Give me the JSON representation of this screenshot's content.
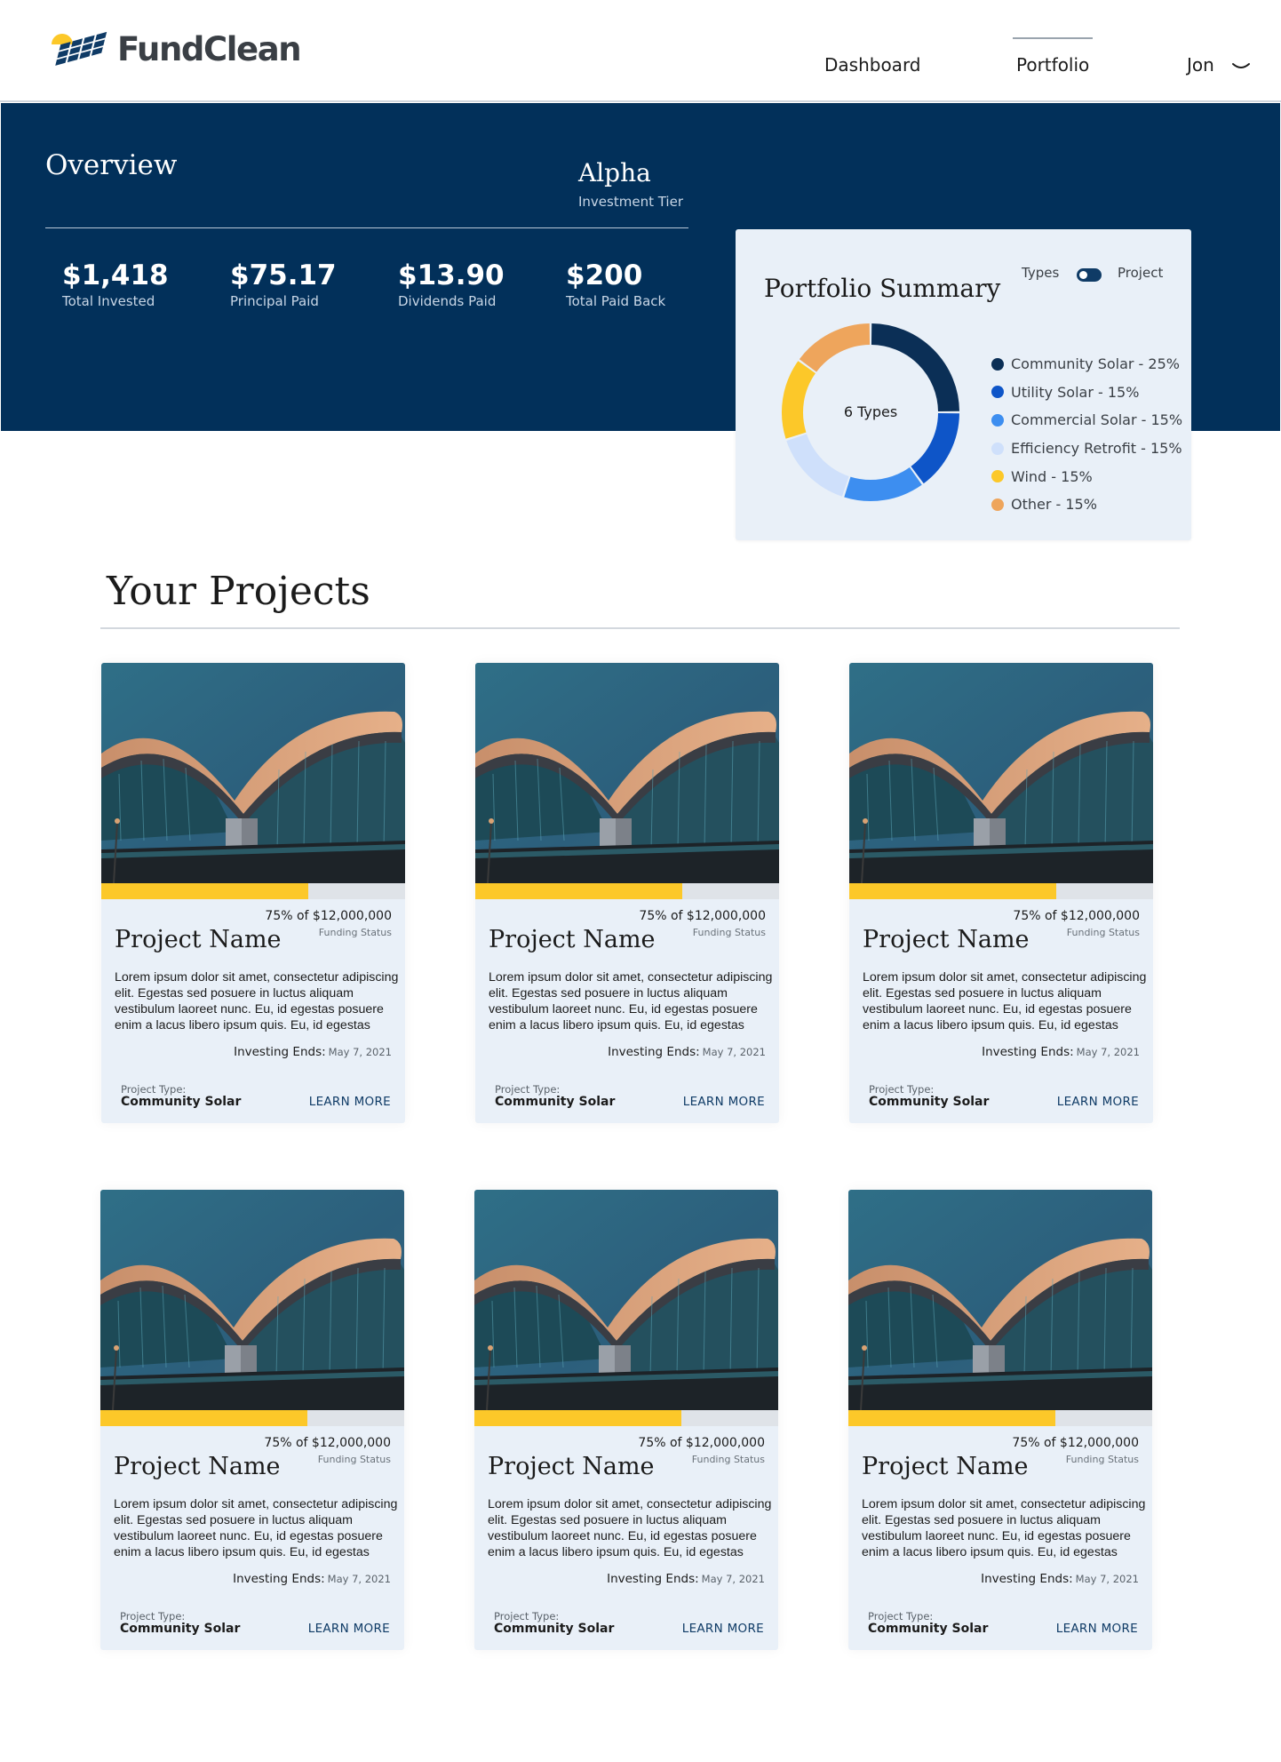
{
  "brand": {
    "name": "FundClean",
    "colors": {
      "navy": "#02305a",
      "accent_yellow": "#fcc829",
      "card_bg": "#e9f0f8",
      "link_blue": "#0f3b66"
    }
  },
  "nav": {
    "items": [
      {
        "label": "Dashboard"
      },
      {
        "label": "Portfolio",
        "active": true
      }
    ],
    "user": {
      "name": "Jon",
      "menu_icon": "chevron-down-icon"
    }
  },
  "overview": {
    "title": "Overview",
    "tier_name": "Alpha",
    "tier_label": "Investment Tier",
    "stats": [
      {
        "value": "$1,418",
        "label": "Total Invested"
      },
      {
        "value": "$75.17",
        "label": "Principal Paid"
      },
      {
        "value": "$13.90",
        "label": "Dividends Paid"
      },
      {
        "value": "$200",
        "label": "Total Paid Back"
      }
    ]
  },
  "summary": {
    "title": "Portfolio Summary",
    "toggle_left": "Types",
    "toggle_right": "Project",
    "center_label": "6 Types",
    "legend": [
      {
        "label": "Community Solar - 25%",
        "value": 25,
        "color": "#0b2f56"
      },
      {
        "label": "Utility Solar - 15%",
        "value": 15,
        "color": "#0e55c8"
      },
      {
        "label": "Commercial Solar - 15%",
        "value": 15,
        "color": "#3d8ef0"
      },
      {
        "label": "Efficiency Retrofit - 15%",
        "value": 15,
        "color": "#cfe0fb"
      },
      {
        "label": "Wind - 15%",
        "value": 15,
        "color": "#fcc829"
      },
      {
        "label": "Other - 15%",
        "value": 15,
        "color": "#eea55c"
      }
    ]
  },
  "projects": {
    "title": "Your Projects",
    "cards": [
      {
        "funding_amount": "75% of $12,000,000",
        "funding_progress": 0.68,
        "funding_label": "Funding Status",
        "name": "Project Name",
        "description": "Lorem ipsum dolor sit amet, consectetur adipiscing elit. Egestas sed posuere in luctus aliquam vestibulum laoreet nunc. Eu, id egestas posuere enim a lacus libero ipsum quis. Eu, id egestas",
        "ends_label": "Investing Ends:",
        "ends_date": "May 7, 2021",
        "type_label": "Project Type:",
        "type": "Community Solar",
        "cta": "LEARN MORE"
      },
      {
        "funding_amount": "75% of $12,000,000",
        "funding_progress": 0.68,
        "funding_label": "Funding Status",
        "name": "Project Name",
        "description": "Lorem ipsum dolor sit amet, consectetur adipiscing elit. Egestas sed posuere in luctus aliquam vestibulum laoreet nunc. Eu, id egestas posuere enim a lacus libero ipsum quis. Eu, id egestas",
        "ends_label": "Investing Ends:",
        "ends_date": "May 7, 2021",
        "type_label": "Project Type:",
        "type": "Community Solar",
        "cta": "LEARN MORE"
      },
      {
        "funding_amount": "75% of $12,000,000",
        "funding_progress": 0.68,
        "funding_label": "Funding Status",
        "name": "Project Name",
        "description": "Lorem ipsum dolor sit amet, consectetur adipiscing elit. Egestas sed posuere in luctus aliquam vestibulum laoreet nunc. Eu, id egestas posuere enim a lacus libero ipsum quis. Eu, id egestas",
        "ends_label": "Investing Ends:",
        "ends_date": "May 7, 2021",
        "type_label": "Project Type:",
        "type": "Community Solar",
        "cta": "LEARN MORE"
      },
      {
        "funding_amount": "75% of $12,000,000",
        "funding_progress": 0.68,
        "funding_label": "Funding Status",
        "name": "Project Name",
        "description": "Lorem ipsum dolor sit amet, consectetur adipiscing elit. Egestas sed posuere in luctus aliquam vestibulum laoreet nunc. Eu, id egestas posuere enim a lacus libero ipsum quis. Eu, id egestas",
        "ends_label": "Investing Ends:",
        "ends_date": "May 7, 2021",
        "type_label": "Project Type:",
        "type": "Community Solar",
        "cta": "LEARN MORE"
      },
      {
        "funding_amount": "75% of $12,000,000",
        "funding_progress": 0.68,
        "funding_label": "Funding Status",
        "name": "Project Name",
        "description": "Lorem ipsum dolor sit amet, consectetur adipiscing elit. Egestas sed posuere in luctus aliquam vestibulum laoreet nunc. Eu, id egestas posuere enim a lacus libero ipsum quis. Eu, id egestas",
        "ends_label": "Investing Ends:",
        "ends_date": "May 7, 2021",
        "type_label": "Project Type:",
        "type": "Community Solar",
        "cta": "LEARN MORE"
      },
      {
        "funding_amount": "75% of $12,000,000",
        "funding_progress": 0.68,
        "funding_label": "Funding Status",
        "name": "Project Name",
        "description": "Lorem ipsum dolor sit amet, consectetur adipiscing elit. Egestas sed posuere in luctus aliquam vestibulum laoreet nunc. Eu, id egestas posuere enim a lacus libero ipsum quis. Eu, id egestas",
        "ends_label": "Investing Ends:",
        "ends_date": "May 7, 2021",
        "type_label": "Project Type:",
        "type": "Community Solar",
        "cta": "LEARN MORE"
      }
    ]
  }
}
